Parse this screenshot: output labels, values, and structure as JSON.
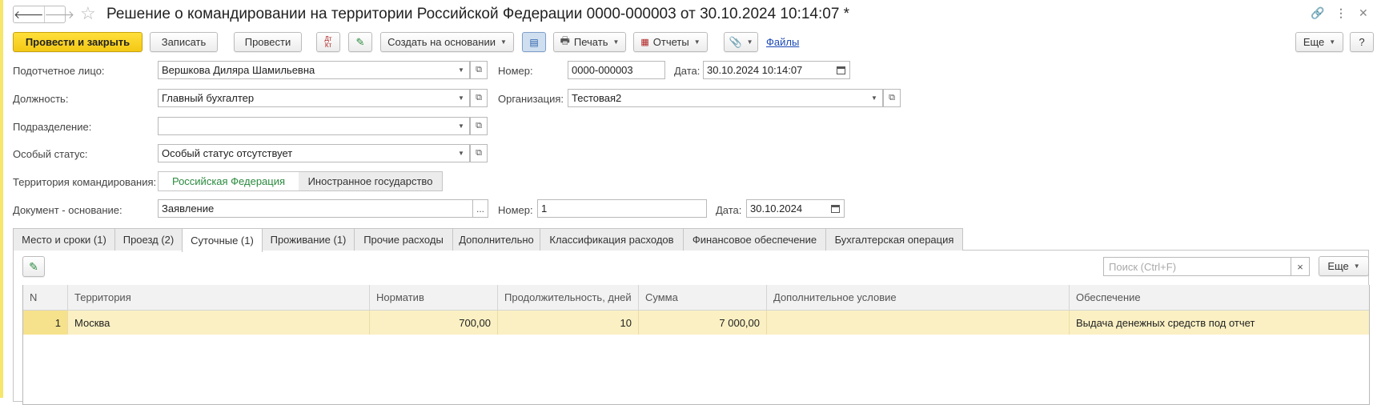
{
  "header": {
    "title": "Решение о командировании на территории Российской Федерации 0000-000003 от 30.10.2024 10:14:07 *"
  },
  "toolbar": {
    "post_close": "Провести и закрыть",
    "save": "Записать",
    "post": "Провести",
    "create_based": "Создать на основании",
    "print": "Печать",
    "reports": "Отчеты",
    "files": "Файлы",
    "more": "Еще",
    "help": "?",
    "dtkt": "Дт Кт"
  },
  "form": {
    "person_label": "Подотчетное лицо:",
    "person_value": "Вершкова Диляра Шамильевна",
    "position_label": "Должность:",
    "position_value": "Главный бухгалтер",
    "division_label": "Подразделение:",
    "division_value": "",
    "status_label": "Особый статус:",
    "status_value": "Особый статус отсутствует",
    "territory_label": "Территория командирования:",
    "territory_opt1": "Российская Федерация",
    "territory_opt2": "Иностранное государство",
    "basis_label": "Документ - основание:",
    "basis_value": "Заявление",
    "basis_select": "...",
    "basis_num_label": "Номер:",
    "basis_num_value": "1",
    "basis_date_label": "Дата:",
    "basis_date_value": "30.10.2024",
    "number_label": "Номер:",
    "number_value": "0000-000003",
    "date_label": "Дата:",
    "date_value": "30.10.2024 10:14:07",
    "org_label": "Организация:",
    "org_value": "Тестовая2"
  },
  "tabs": [
    {
      "label": "Место и сроки (1)"
    },
    {
      "label": "Проезд (2)"
    },
    {
      "label": "Суточные (1)"
    },
    {
      "label": "Проживание (1)"
    },
    {
      "label": "Прочие расходы"
    },
    {
      "label": "Дополнительно"
    },
    {
      "label": "Классификация расходов"
    },
    {
      "label": "Финансовое обеспечение"
    },
    {
      "label": "Бухгалтерская операция"
    }
  ],
  "active_tab": "Суточные (1)",
  "table_toolbar": {
    "search_placeholder": "Поиск (Ctrl+F)",
    "clear": "×",
    "more": "Еще"
  },
  "table": {
    "columns": [
      "N",
      "Территория",
      "Норматив",
      "Продолжительность, дней",
      "Сумма",
      "Дополнительное условие",
      "Обеспечение"
    ],
    "rows": [
      {
        "n": "1",
        "territory": "Москва",
        "norm": "700,00",
        "days": "10",
        "sum": "7 000,00",
        "condition": "",
        "provision": "Выдача денежных средств под отчет"
      }
    ]
  },
  "colors": {
    "primary_button": "#f4c915",
    "selected_row": "#fbf0c3",
    "active_option": "#2a8a3e",
    "link": "#1a48b5"
  }
}
